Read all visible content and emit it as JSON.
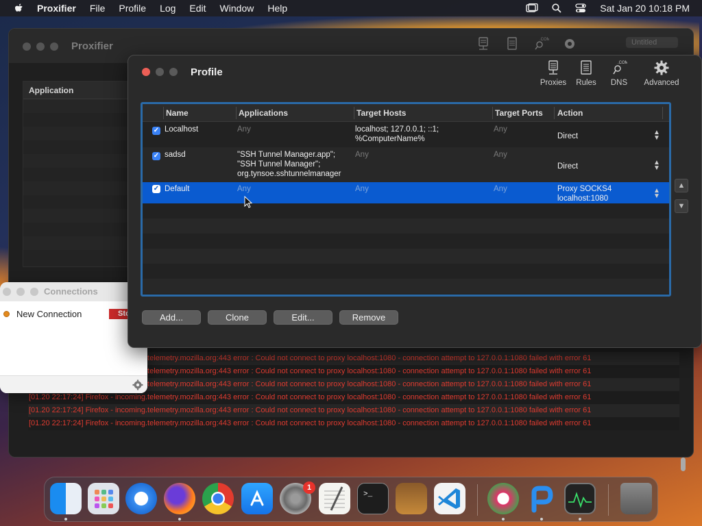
{
  "menubar": {
    "app": "Proxifier",
    "items": [
      "File",
      "Profile",
      "Log",
      "Edit",
      "Window",
      "Help"
    ],
    "clock": "Sat Jan 20  10:18 PM"
  },
  "main_window": {
    "title": "Proxifier",
    "profile_select": "Untitled",
    "app_panel_header": "Application"
  },
  "log": {
    "lines": [
      "[01.20 22:17:24] Firefox - incoming.telemetry.mozilla.org:443 error : Could not connect to proxy localhost:1080 - connection attempt to 127.0.0.1:1080 failed with error 61",
      "[01.20 22:17:24] Firefox - incoming.telemetry.mozilla.org:443 error : Could not connect to proxy localhost:1080 - connection attempt to 127.0.0.1:1080 failed with error 61",
      "[01.20 22:17:24] Firefox - incoming.telemetry.mozilla.org:443 error : Could not connect to proxy localhost:1080 - connection attempt to 127.0.0.1:1080 failed with error 61",
      "[01.20 22:17:24] Firefox - incoming.telemetry.mozilla.org:443 error : Could not connect to proxy localhost:1080 - connection attempt to 127.0.0.1:1080 failed with error 61",
      "[01.20 22:17:24] Firefox - incoming.telemetry.mozilla.org:443 error : Could not connect to proxy localhost:1080 - connection attempt to 127.0.0.1:1080 failed with error 61",
      "[01.20 22:17:24] Firefox - incoming.telemetry.mozilla.org:443 error : Could not connect to proxy localhost:1080 - connection attempt to 127.0.0.1:1080 failed with error 61"
    ]
  },
  "connections": {
    "title": "Connections",
    "item": "New Connection",
    "status": "Sto"
  },
  "profile": {
    "title": "Profile",
    "toolbar": {
      "proxies": "Proxies",
      "rules": "Rules",
      "dns": "DNS",
      "advanced": "Advanced"
    },
    "columns": {
      "name": "Name",
      "applications": "Applications",
      "target_hosts": "Target Hosts",
      "target_ports": "Target Ports",
      "action": "Action"
    },
    "rules": [
      {
        "name": "Localhost",
        "applications": [
          "Any"
        ],
        "hosts": [
          "localhost; 127.0.0.1; ::1;",
          "%ComputerName%"
        ],
        "ports": "Any",
        "action": [
          "Direct"
        ]
      },
      {
        "name": "sadsd",
        "applications": [
          "\"SSH Tunnel Manager.app\";",
          "\"SSH Tunnel Manager\";",
          "org.tynsoe.sshtunnelmanager"
        ],
        "hosts": [
          "Any"
        ],
        "ports": "Any",
        "action": [
          "Direct"
        ]
      },
      {
        "name": "Default",
        "applications": [
          "Any"
        ],
        "hosts": [
          "Any"
        ],
        "ports": "Any",
        "action": [
          "Proxy SOCKS4",
          "localhost:1080"
        ]
      }
    ],
    "buttons": {
      "add": "Add...",
      "clone": "Clone",
      "edit": "Edit...",
      "remove": "Remove"
    }
  },
  "dock": {
    "system_preferences_badge": "1"
  },
  "colors": {
    "selection": "#0a5bd0",
    "error_text": "#e03b30",
    "focus_ring": "#2a6aa8"
  }
}
